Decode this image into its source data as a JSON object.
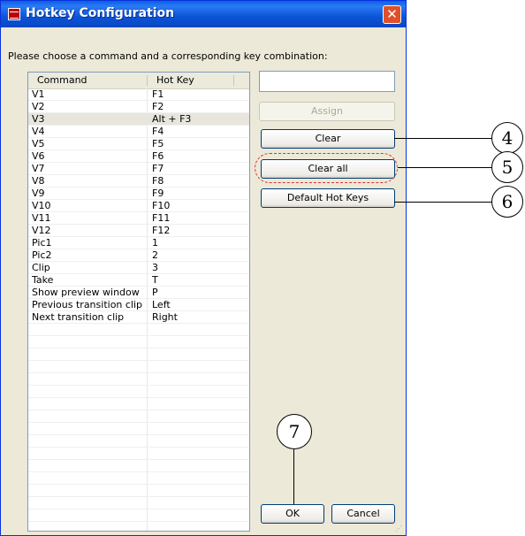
{
  "window": {
    "title": "Hotkey Configuration",
    "close_glyph": "✕",
    "app_icon": "filmstrip-icon"
  },
  "prompt": "Please choose a command and a corresponding key combination:",
  "list": {
    "columns": [
      "Command",
      "Hot Key"
    ],
    "rows": [
      {
        "command": "V1",
        "key": "F1"
      },
      {
        "command": "V2",
        "key": "F2"
      },
      {
        "command": "V3",
        "key": "Alt + F3",
        "selected": true
      },
      {
        "command": "V4",
        "key": "F4"
      },
      {
        "command": "V5",
        "key": "F5"
      },
      {
        "command": "V6",
        "key": "F6"
      },
      {
        "command": "V7",
        "key": "F7"
      },
      {
        "command": "V8",
        "key": "F8"
      },
      {
        "command": "V9",
        "key": "F9"
      },
      {
        "command": "V10",
        "key": "F10"
      },
      {
        "command": "V11",
        "key": "F11"
      },
      {
        "command": "V12",
        "key": "F12"
      },
      {
        "command": "Pic1",
        "key": "1"
      },
      {
        "command": "Pic2",
        "key": "2"
      },
      {
        "command": "Clip",
        "key": "3"
      },
      {
        "command": "Take",
        "key": "T"
      },
      {
        "command": "Show preview window",
        "key": "P"
      },
      {
        "command": "Previous transition clip",
        "key": "Left"
      },
      {
        "command": "Next transition clip",
        "key": "Right"
      }
    ]
  },
  "hotkey_input": {
    "value": ""
  },
  "buttons": {
    "assign": "Assign",
    "clear": "Clear",
    "clear_all": "Clear all",
    "default_hot_keys": "Default Hot Keys",
    "ok": "OK",
    "cancel": "Cancel"
  },
  "callouts": {
    "c4": "4",
    "c5": "5",
    "c6": "6",
    "c7": "7"
  },
  "colors": {
    "titlebar": "#0a5ee8",
    "callout_dash": "#e03030",
    "selected_row": "#e8e6dc"
  }
}
